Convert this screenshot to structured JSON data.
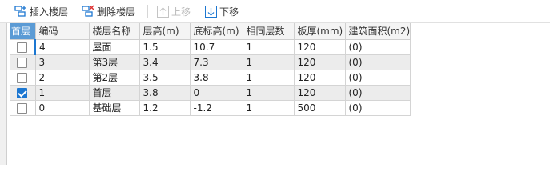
{
  "toolbar": {
    "insert_label": "插入楼层",
    "delete_label": "删除楼层",
    "move_up_label": "上移",
    "move_down_label": "下移"
  },
  "table": {
    "corner_label": "首层",
    "headers": [
      "编码",
      "楼层名称",
      "层高(m)",
      "底标高(m)",
      "相同层数",
      "板厚(mm)",
      "建筑面积(m2)"
    ],
    "rows": [
      {
        "checked": false,
        "cells": [
          "4",
          "屋面",
          "1.5",
          "10.7",
          "1",
          "120",
          "(0)"
        ]
      },
      {
        "checked": false,
        "cells": [
          "3",
          "第3层",
          "3.4",
          "7.3",
          "1",
          "120",
          "(0)"
        ]
      },
      {
        "checked": false,
        "cells": [
          "2",
          "第2层",
          "3.5",
          "3.8",
          "1",
          "120",
          "(0)"
        ]
      },
      {
        "checked": true,
        "cells": [
          "1",
          "首层",
          "3.8",
          "0",
          "1",
          "120",
          "(0)"
        ]
      },
      {
        "checked": false,
        "cells": [
          "0",
          "基础层",
          "1.2",
          "-1.2",
          "1",
          "500",
          "(0)"
        ]
      }
    ]
  },
  "colors": {
    "accent": "#1c77d1",
    "corner_header": "#5b9bd5",
    "alt_row": "#ececec"
  },
  "icons": {
    "insert": "insert-floor-icon",
    "delete": "delete-floor-icon",
    "move_up": "arrow-up-icon",
    "move_down": "arrow-down-icon"
  }
}
